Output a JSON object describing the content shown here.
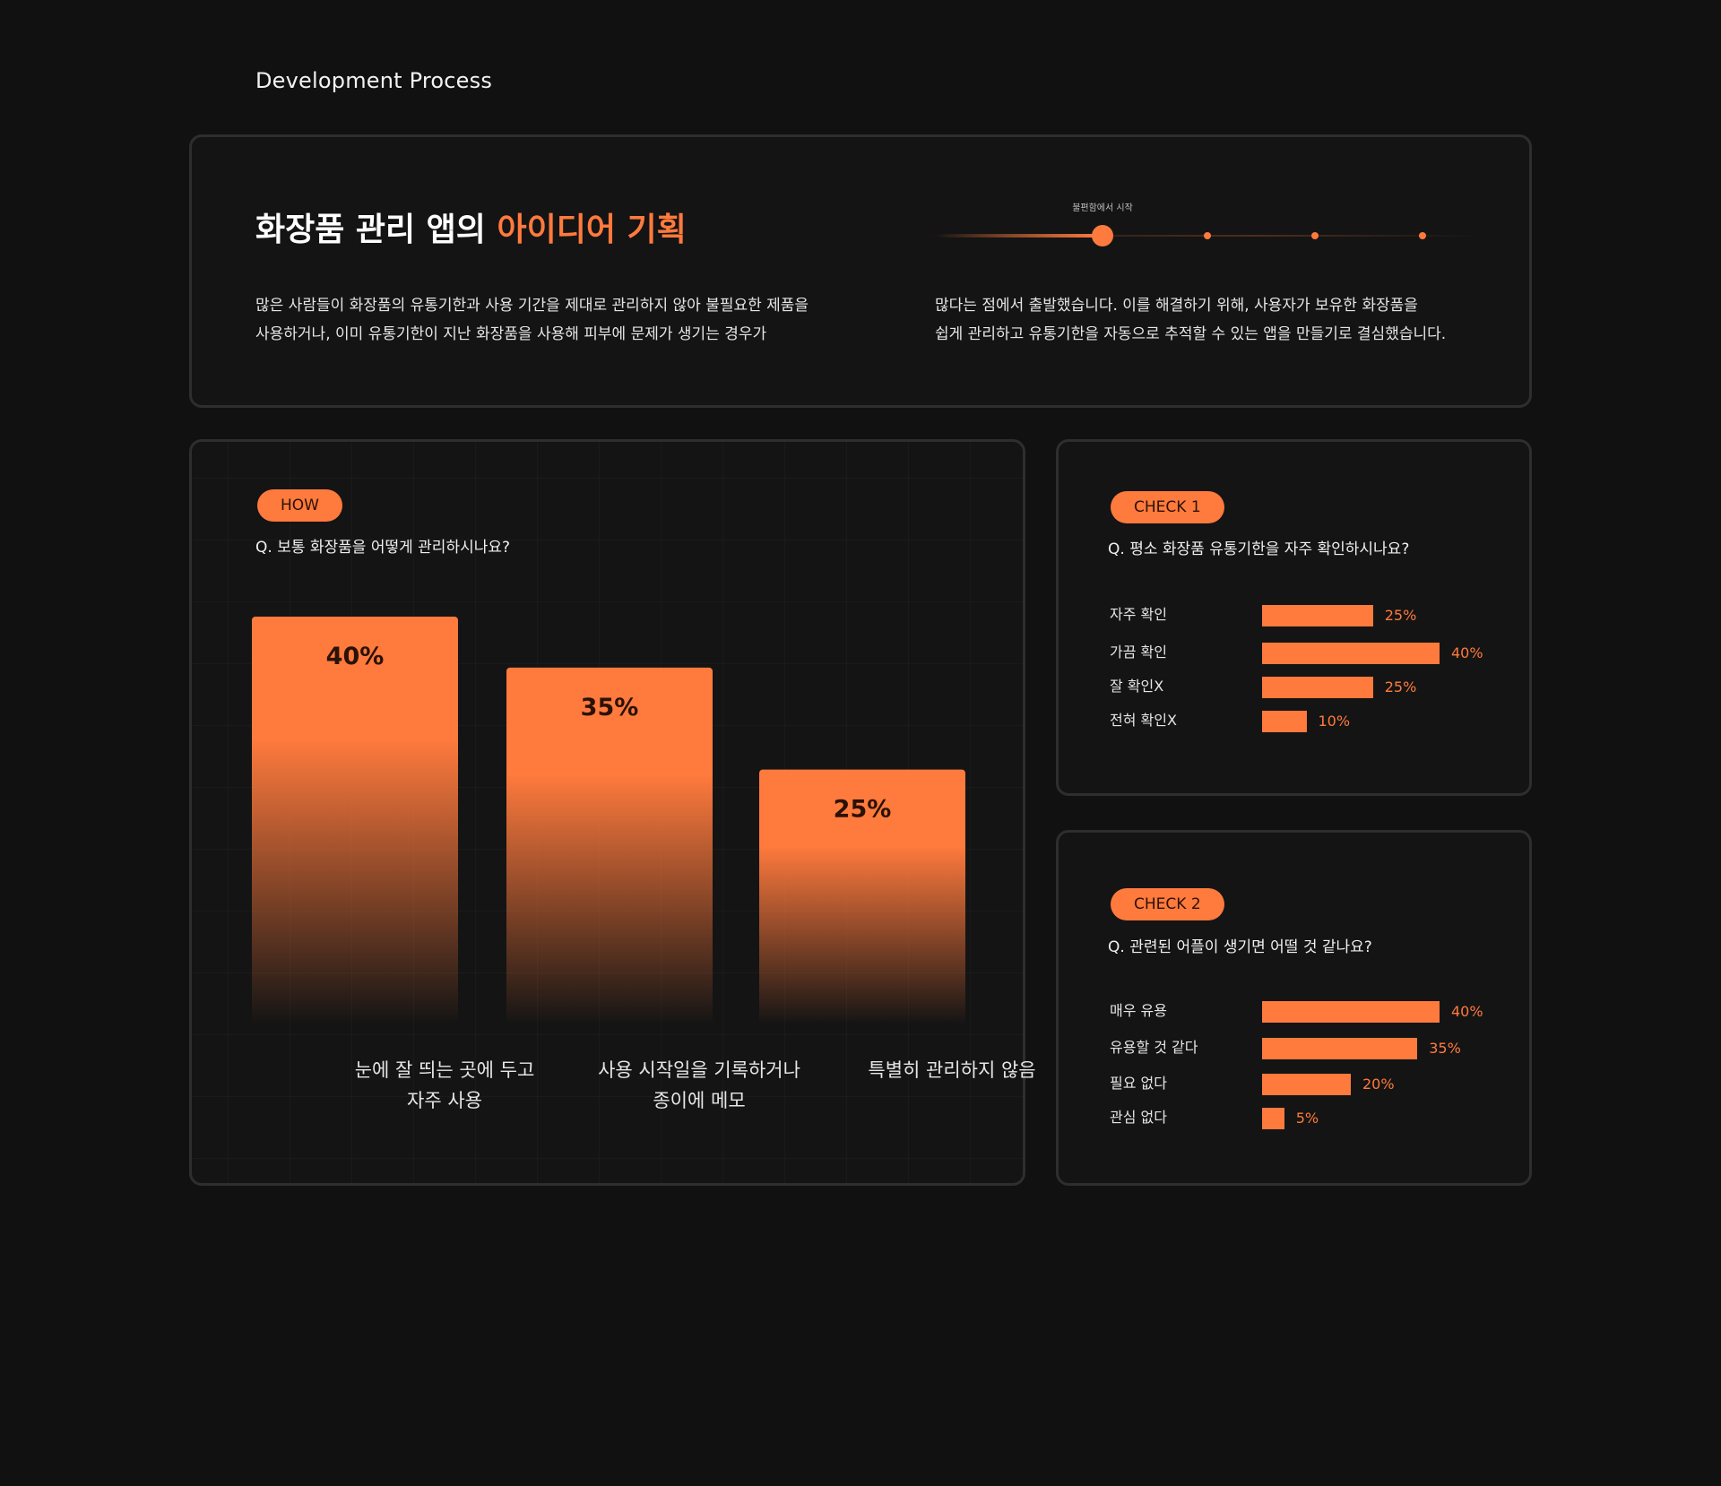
{
  "section_label": "Development Process",
  "idea": {
    "title_main": "화장품 관리 앱의 ",
    "title_highlight": "아이디어 기획",
    "timeline_label": "불편함에서 시작",
    "para_left": [
      "많은 사람들이 화장품의 유통기한과 사용 기간을 제대로 관리하지 않아 불필요한 제품을",
      "사용하거나, 이미 유통기한이 지난 화장품을 사용해 피부에 문제가 생기는 경우가"
    ],
    "para_right": [
      "많다는 점에서 출발했습니다. 이를 해결하기 위해, 사용자가 보유한 화장품을",
      "쉽게 관리하고 유통기한을 자동으로 추적할 수 있는 앱을 만들기로 결심했습니다."
    ]
  },
  "how": {
    "tag": "HOW",
    "question": "Q. 보통 화장품을 어떻게 관리하시나요?",
    "categories": [
      [
        "눈에 잘 띄는 곳에 두고",
        "자주 사용"
      ],
      [
        "사용 시작일을 기록하거나",
        "종이에 메모"
      ],
      [
        "특별히 관리하지 않음"
      ]
    ]
  },
  "check1": {
    "tag": "CHECK 1",
    "question": "Q. 평소 화장품 유통기한을 자주 확인하시나요?"
  },
  "check2": {
    "tag": "CHECK 2",
    "question": "Q. 관련된 어플이 생기면 어떨 것 같나요?"
  },
  "colors": {
    "accent": "#ff7a3d",
    "background": "#111111",
    "card_border": "#2e2e2e"
  },
  "chart_data": [
    {
      "type": "bar",
      "categories": [
        "눈에 잘 띄는 곳에 두고 자주 사용",
        "사용 시작일을 기록하거나 종이에 메모",
        "특별히 관리하지 않음"
      ],
      "values": [
        40,
        35,
        25
      ],
      "value_labels": [
        "40%",
        "35%",
        "25%"
      ],
      "title": "Q. 보통 화장품을 어떻게 관리하시나요?",
      "ylim": [
        0,
        40
      ]
    },
    {
      "type": "bar",
      "orientation": "horizontal",
      "categories": [
        "자주 확인",
        "가끔 확인",
        "잘 확인X",
        "전혀 확인X"
      ],
      "values": [
        25,
        40,
        25,
        10
      ],
      "value_labels": [
        "25%",
        "40%",
        "25%",
        "10%"
      ],
      "title": "Q. 평소 화장품 유통기한을 자주 확인하시나요?",
      "xlim": [
        0,
        40
      ]
    },
    {
      "type": "bar",
      "orientation": "horizontal",
      "categories": [
        "매우 유용",
        "유용할 것 같다",
        "필요 없다",
        "관심 없다"
      ],
      "values": [
        40,
        35,
        20,
        5
      ],
      "value_labels": [
        "40%",
        "35%",
        "20%",
        "5%"
      ],
      "title": "Q. 관련된 어플이 생기면 어떨 것 같나요?",
      "xlim": [
        0,
        40
      ]
    }
  ]
}
